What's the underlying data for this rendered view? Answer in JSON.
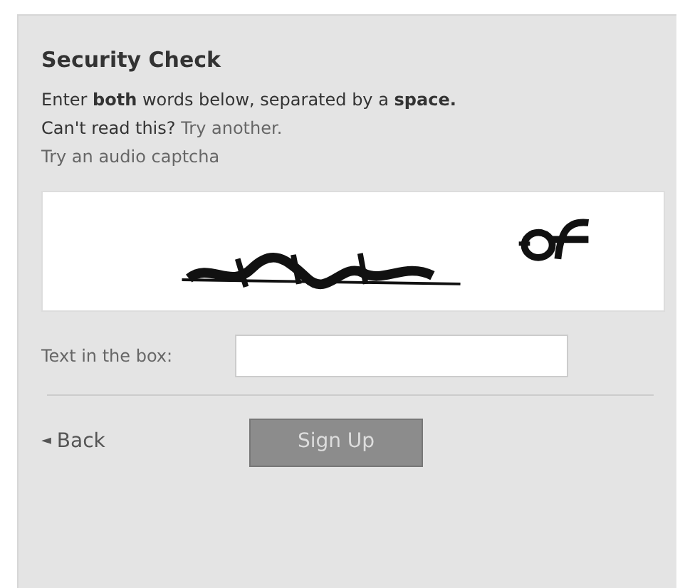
{
  "title": "Security Check",
  "instructions": "Enter **both** words below, separated by a **space.**",
  "cant_read": {
    "text": "Can't read this?",
    "link": "Try another."
  },
  "audio_link": "Try an audio captcha",
  "field": {
    "label": "Text in the box:"
  },
  "back": {
    "icon": "◄",
    "label": "Back"
  },
  "submit": {
    "label": "Sign Up",
    "disabled": true
  }
}
